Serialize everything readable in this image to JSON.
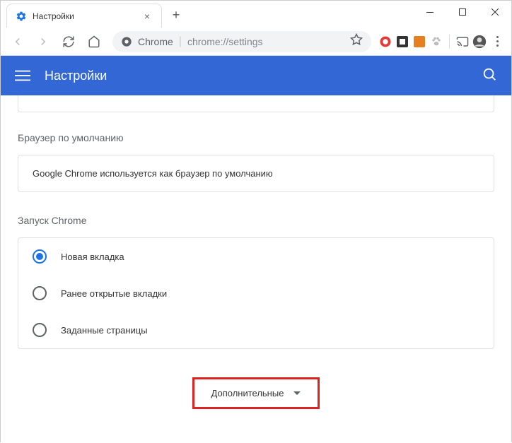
{
  "window": {
    "tab_title": "Настройки"
  },
  "addressbar": {
    "url_label": "Chrome",
    "url_path": "chrome://settings"
  },
  "header": {
    "title": "Настройки"
  },
  "sections": {
    "default_browser": {
      "title": "Браузер по умолчанию",
      "text": "Google Chrome используется как браузер по умолчанию"
    },
    "startup": {
      "title": "Запуск Chrome",
      "options": [
        {
          "label": "Новая вкладка",
          "selected": true
        },
        {
          "label": "Ранее открытые вкладки",
          "selected": false
        },
        {
          "label": "Заданные страницы",
          "selected": false
        }
      ]
    }
  },
  "advanced": {
    "label": "Дополнительные"
  }
}
